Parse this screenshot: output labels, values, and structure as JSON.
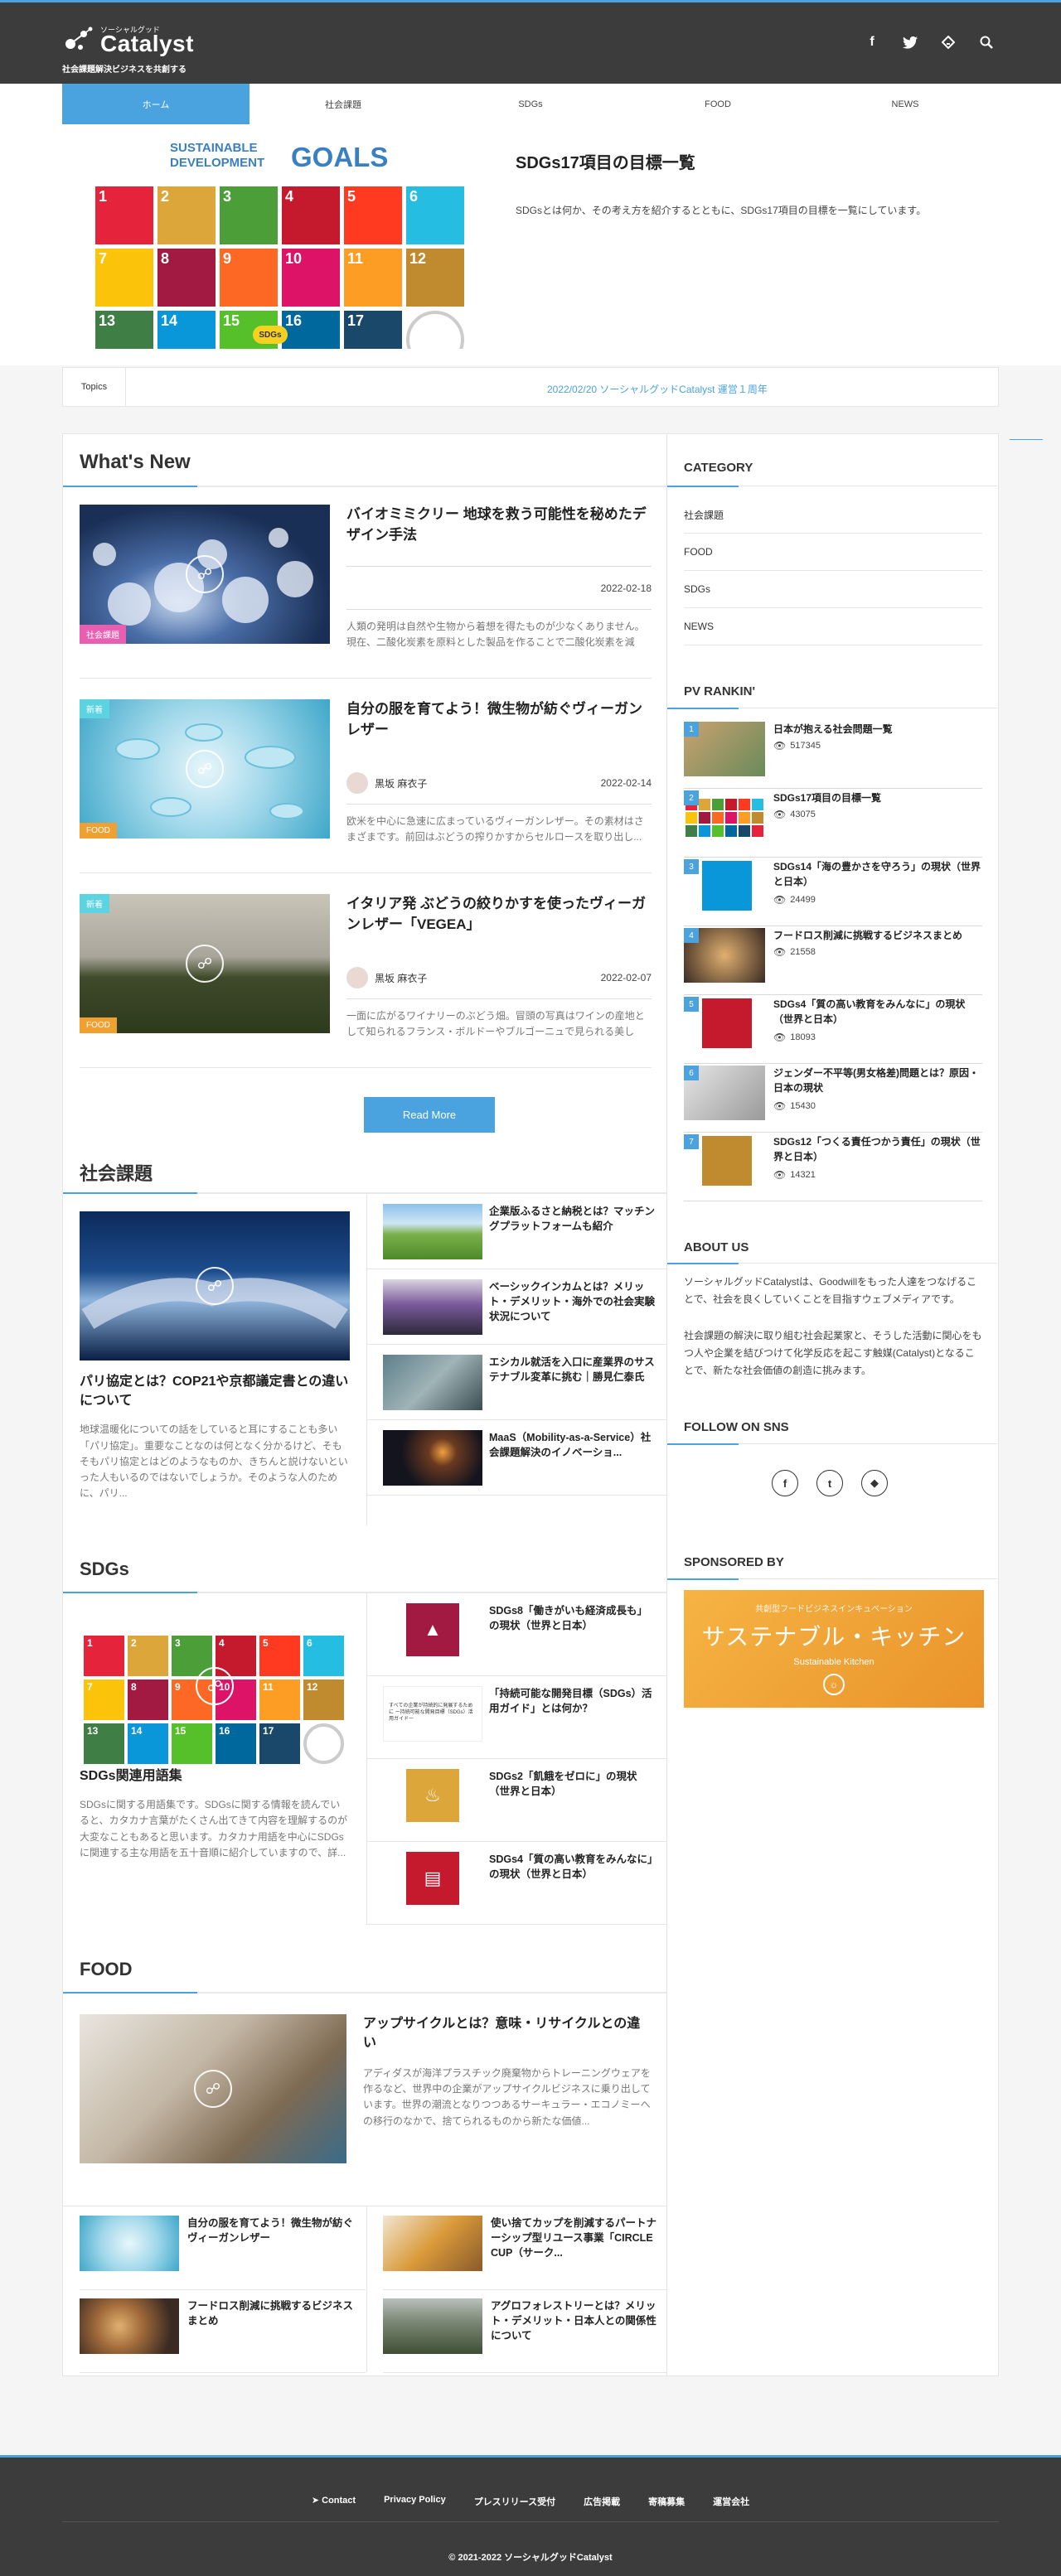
{
  "header": {
    "logo_small": "ソーシャルグッド",
    "logo_big": "Catalyst",
    "tagline": "社会課題解決ビジネスを共創する"
  },
  "nav": [
    "ホーム",
    "社会課題",
    "SDGs",
    "FOOD",
    "NEWS"
  ],
  "hero": {
    "title": "SDGs17項目の目標一覧",
    "desc": "SDGsとは何か、その考え方を紹介するとともに、SDGs17項目の目標を一覧にしています。",
    "image_title_a": "SUSTAINABLE",
    "image_title_b": "DEVELOPMENT",
    "image_title_c": "GOALS",
    "badge": "SDGs"
  },
  "topics": {
    "label": "Topics",
    "text": "2022/02/20 ソーシャルグッドCatalyst 運営１周年"
  },
  "whatsnew": {
    "heading": "What's New",
    "readmore": "Read More",
    "posts": [
      {
        "title": "バイオミミクリー 地球を救う可能性を秘めたデザイン手法",
        "date": "2022-02-18",
        "excerpt": "人類の発明は自然や生物から着想を得たものが少なくありません。現在、二酸化炭素を原料とした製品を作ることで二酸化炭素を減ら...",
        "cat": "社会課題",
        "author": ""
      },
      {
        "title": "自分の服を育てよう！微生物が紡ぐヴィーガンレザー",
        "date": "2022-02-14",
        "excerpt": "欧米を中心に急速に広まっているヴィーガンレザー。その素材はさまざまです。前回はぶどうの搾りかすからセルロースを取り出し...",
        "cat": "FOOD",
        "author": "黒坂 麻衣子",
        "new": "新着"
      },
      {
        "title": "イタリア発 ぶどうの絞りかすを使ったヴィーガンレザー「VEGEA」",
        "date": "2022-02-07",
        "excerpt": "一面に広がるワイナリーのぶどう畑。冒頭の写真はワインの産地として知られるフランス・ボルドーやブルゴーニュで見られる美しい...",
        "cat": "FOOD",
        "author": "黒坂 麻衣子",
        "new": "新着"
      }
    ]
  },
  "social": {
    "heading": "社会課題",
    "big": {
      "title": "パリ協定とは？COP21や京都議定書との違いについて",
      "excerpt": "地球温暖化についての話をしていると耳にすることも多い「パリ協定」。重要なことなのは何となく分かるけど、そもそもパリ協定とはどのようなものか、きちんと説けないといった人もいるのではないでしょうか。そのような人のために、パリ..."
    },
    "list": [
      "企業版ふるさと納税とは？マッチングプラットフォームも紹介",
      "ベーシックインカムとは？メリット・デメリット・海外での社会実験状況について",
      "エシカル就活を入口に産業界のサステナブル変革に挑む｜勝見仁泰氏",
      "MaaS（Mobility-as-a-Service）社会課題解決のイノベーショ..."
    ]
  },
  "sdgs": {
    "heading": "SDGs",
    "big": {
      "title": "SDGs関連用語集",
      "excerpt": "SDGsに関する用語集です。SDGsに関する情報を読んでいると、カタカナ言葉がたくさん出てきて内容を理解するのが大変なこともあると思います。カタカナ用語を中心にSDGsに関連する主な用語を五十音順に紹介していますので、詳..."
    },
    "list": [
      "SDGs8「働きがいも経済成長も」の現状（世界と日本）",
      "「持続可能な開発目標（SDGs）活用ガイド」とは何か？",
      "SDGs2「飢餓をゼロに」の現状（世界と日本）",
      "SDGs4「質の高い教育をみんなに」の現状（世界と日本）"
    ],
    "doc_text": "すべての企業が持続的に発展するために ー持続可能な開発目標（SDGs）活用ガイドー"
  },
  "food": {
    "heading": "FOOD",
    "big": {
      "title": "アップサイクルとは？意味・リサイクルとの違い",
      "excerpt": "アディダスが海洋プラスチック廃棄物からトレーニングウェアを作るなど、世界中の企業がアップサイクルビジネスに乗り出しています。世界の潮流となりつつあるサーキュラー・エコノミーへの移行のなかで、捨てられるものから新たな価値..."
    },
    "small": [
      "自分の服を育てよう！微生物が紡ぐヴィーガンレザー",
      "使い捨てカップを削減するパートナーシップ型リユース事業「CIRCLE CUP（サーク...",
      "フードロス削減に挑戦するビジネスまとめ",
      "アグロフォレストリーとは？メリット・デメリット・日本人との関係性について"
    ]
  },
  "sidebar": {
    "category_h": "CATEGORY",
    "categories": [
      "社会課題",
      "FOOD",
      "SDGs",
      "NEWS"
    ],
    "ranking_h": "PV RANKIN'",
    "ranking": [
      {
        "n": "1",
        "t": "日本が抱える社会問題一覧",
        "v": "517345"
      },
      {
        "n": "2",
        "t": "SDGs17項目の目標一覧",
        "v": "43075"
      },
      {
        "n": "3",
        "t": "SDGs14「海の豊かさを守ろう」の現状（世界と日本）",
        "v": "24499"
      },
      {
        "n": "4",
        "t": "フードロス削減に挑戦するビジネスまとめ",
        "v": "21558"
      },
      {
        "n": "5",
        "t": "SDGs4「質の高い教育をみんなに」の現状（世界と日本）",
        "v": "18093"
      },
      {
        "n": "6",
        "t": "ジェンダー不平等(男女格差)問題とは？原因・日本の現状",
        "v": "15430"
      },
      {
        "n": "7",
        "t": "SDGs12「つくる責任つかう責任」の現状（世界と日本）",
        "v": "14321"
      }
    ],
    "about_h": "ABOUT US",
    "about_p1": "ソーシャルグッドCatalystは、Goodwillをもった人達をつなげることで、社会を良くしていくことを目指すウェブメディアです。",
    "about_p2": "社会課題の解決に取り組む社会起業家と、そうした活動に関心をもつ人や企業を結びつけて化学反応を起こす触媒(Catalyst)となることで、新たな社会価値の創造に挑みます。",
    "sns_h": "FOLLOW ON SNS",
    "sponsor_h": "SPONSORED BY",
    "sponsor_small": "共創型フードビジネスインキュベーション",
    "sponsor_big": "サステナブル・キッチン",
    "sponsor_en": "Sustainable Kitchen"
  },
  "footer": {
    "links": [
      "Contact",
      "Privacy Policy",
      "プレスリリース受付",
      "広告掲載",
      "寄稿募集",
      "運営会社"
    ],
    "copy": "© 2021-2022 ソーシャルグッドCatalyst"
  },
  "colors": {
    "accent": "#4aa3df",
    "header": "#3c3c3c",
    "cat_social": "#e85fb2",
    "cat_food": "#f0a030",
    "new_badge": "#5bd3e0"
  }
}
